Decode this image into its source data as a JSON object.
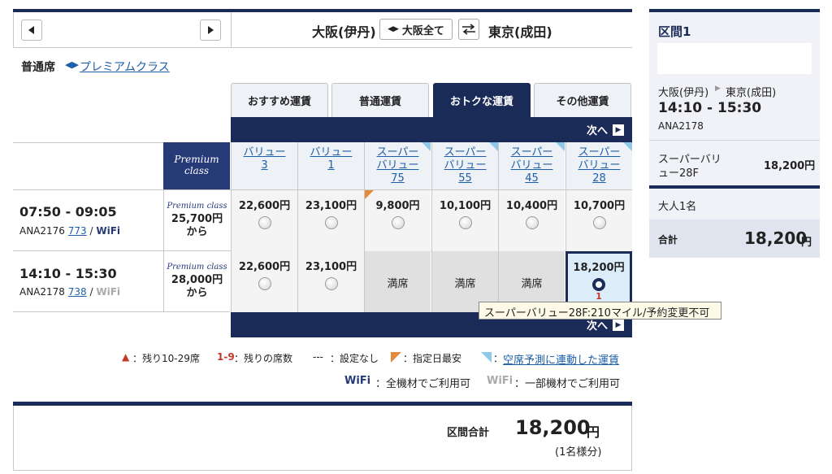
{
  "header": {
    "origin": "大阪(伊丹)",
    "all_button": "大阪全て",
    "destination": "東京(成田)"
  },
  "cabin": {
    "current": "普通席",
    "alternate": "プレミアムクラス"
  },
  "tabs": [
    {
      "label": "おすすめ運賃",
      "active": false
    },
    {
      "label": "普通運賃",
      "active": false
    },
    {
      "label": "おトクな運賃",
      "active": true
    },
    {
      "label": "その他運賃",
      "active": false
    }
  ],
  "next_label": "次へ",
  "premium_header": [
    "Premium",
    "class"
  ],
  "fare_columns": [
    {
      "l1": "バリュー",
      "l2": "3",
      "dyn": false
    },
    {
      "l1": "バリュー",
      "l2": "1",
      "dyn": false
    },
    {
      "l1": "スーパー",
      "l2": "バリュー",
      "l3": "75",
      "dyn": true
    },
    {
      "l1": "スーパー",
      "l2": "バリュー",
      "l3": "55",
      "dyn": true
    },
    {
      "l1": "スーパー",
      "l2": "バリュー",
      "l3": "45",
      "dyn": true
    },
    {
      "l1": "スーパー",
      "l2": "バリュー",
      "l3": "28",
      "dyn": true
    }
  ],
  "flights": [
    {
      "time": "07:50 - 09:05",
      "number": "ANA2176",
      "aircraft": "773",
      "wifi": "WiFi",
      "premium_logo": "Premium class",
      "premium_price": "25,700円",
      "premium_from": "から",
      "fares": [
        {
          "price": "22,600円"
        },
        {
          "price": "23,100円"
        },
        {
          "price": "9,800円",
          "cheapest": true
        },
        {
          "price": "10,100円"
        },
        {
          "price": "10,400円"
        },
        {
          "price": "10,700円"
        }
      ]
    },
    {
      "time": "14:10 - 15:30",
      "number": "ANA2178",
      "aircraft": "738",
      "wifi": "WiFi",
      "premium_logo": "Premium class",
      "premium_price": "28,000円",
      "premium_from": "から",
      "fares": [
        {
          "price": "22,600円"
        },
        {
          "price": "23,100円"
        },
        {
          "full": "満席"
        },
        {
          "full": "満席"
        },
        {
          "full": "満席"
        },
        {
          "price": "18,200円",
          "selected": true,
          "seats": "1"
        }
      ]
    }
  ],
  "tooltip": "スーパーバリュー28F:210マイル/予約変更不可",
  "legend": {
    "remaining": "：残り10-29席",
    "count_key": "1-9",
    "count": "：残りの席数",
    "none_key": "---",
    "none": "：設定なし",
    "cheapest": "：指定日最安",
    "dynamic": "空席予測に連動した運賃",
    "wifi_all_logo": "WiFi",
    "wifi_all": "：全機材でご利用可",
    "wifi_some_logo": "WiFi",
    "wifi_some": "：一部機材でご利用可"
  },
  "total": {
    "label": "区間合計",
    "amount": "18,200",
    "unit": "円",
    "note": "(1名様分)"
  },
  "summary": {
    "title": "区間1",
    "origin": "大阪(伊丹)",
    "destination": "東京(成田)",
    "time": "14:10 - 15:30",
    "flight": "ANA2178",
    "fare_name_1": "スーパーバリ",
    "fare_name_2": "ュー28F",
    "fare_price": "18,200円",
    "pax": "大人1名",
    "total_label": "合計",
    "total_amount": "18,200",
    "total_unit": "円"
  },
  "colors": {
    "navy": "#1b2b57",
    "link": "#1d5fa8",
    "orange": "#e5893b",
    "sky": "#8ec9ea"
  }
}
